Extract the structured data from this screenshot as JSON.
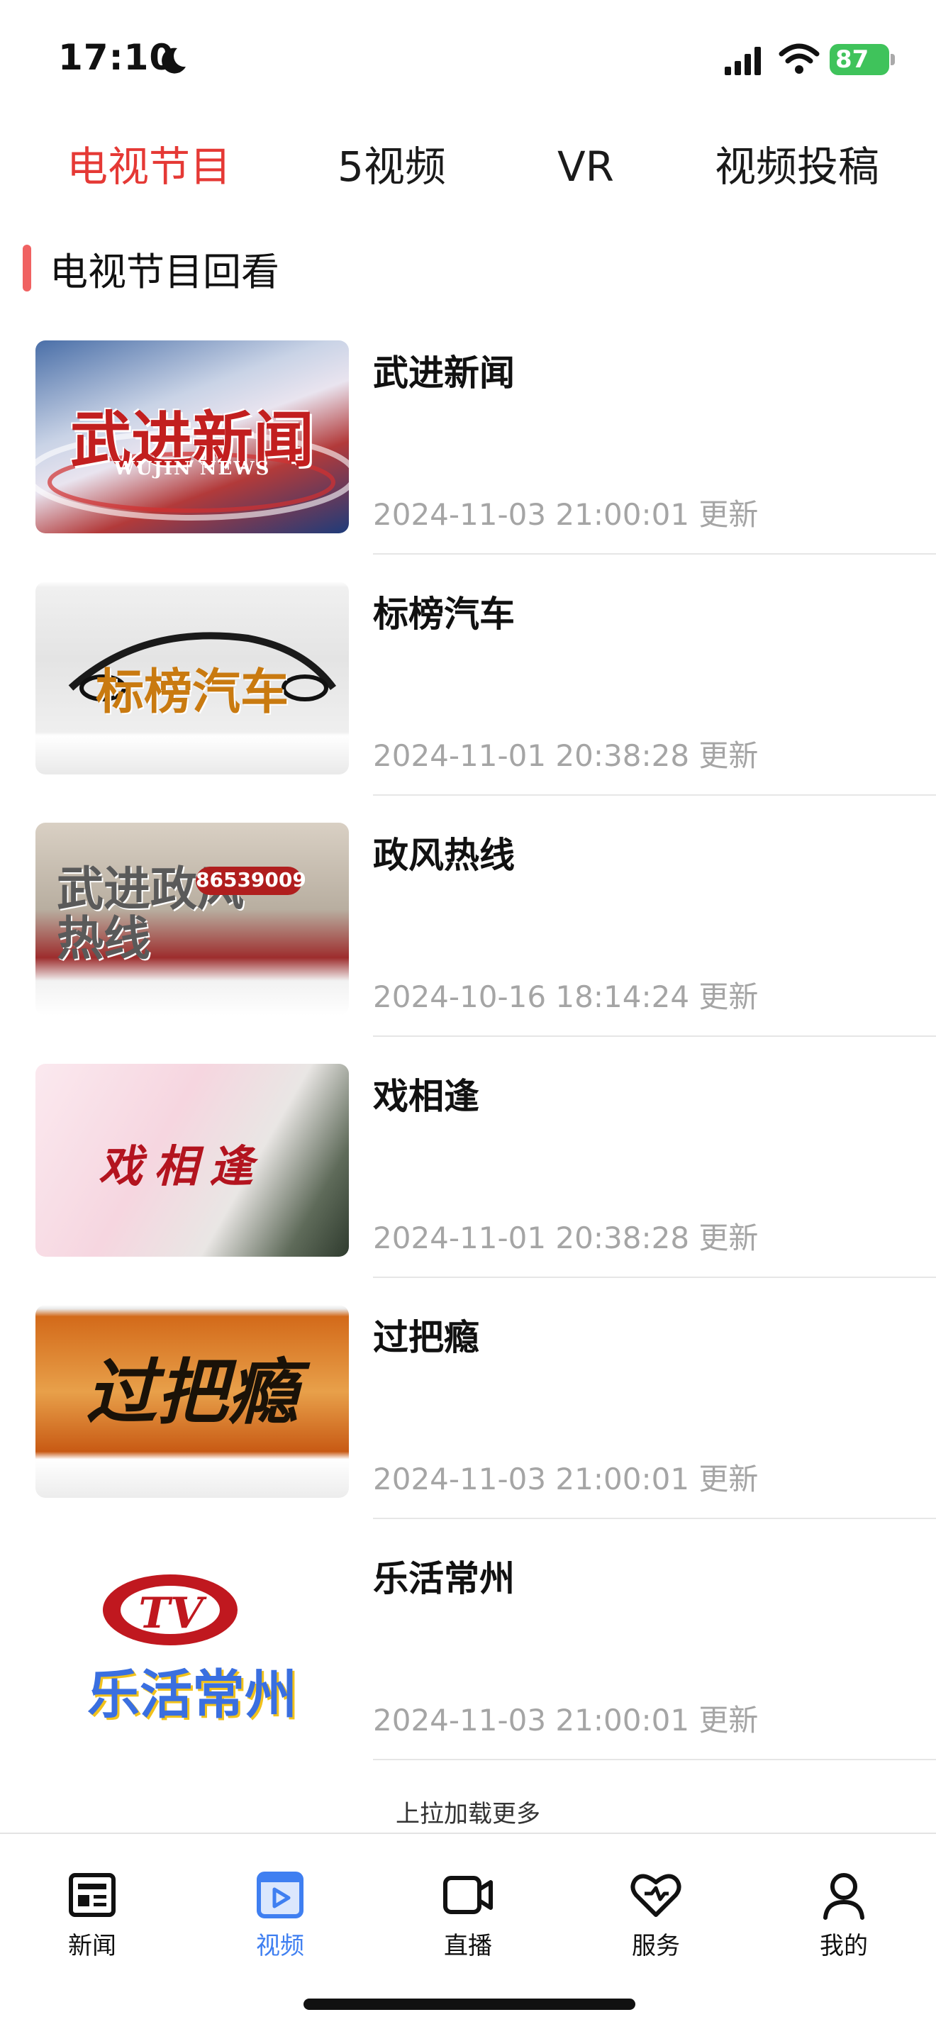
{
  "status": {
    "time": "17:10",
    "battery": "87"
  },
  "top_tabs": [
    {
      "label": "电视节目",
      "active": true
    },
    {
      "label": "5视频",
      "active": false
    },
    {
      "label": "VR",
      "active": false
    },
    {
      "label": "视频投稿",
      "active": false
    }
  ],
  "section": {
    "title": "电视节目回看"
  },
  "programs": [
    {
      "title": "武进新闻",
      "date": "2024-11-03 21:00:01 更新",
      "thumb_text": "武进新闻",
      "thumb_subtext": "WUJIN NEWS"
    },
    {
      "title": "标榜汽车",
      "date": "2024-11-01 20:38:28 更新",
      "thumb_text": "标榜汽车"
    },
    {
      "title": "政风热线",
      "date": "2024-10-16 18:14:24 更新",
      "thumb_text": "武进政风热线",
      "thumb_subtext": "86539009"
    },
    {
      "title": "戏相逢",
      "date": "2024-11-01 20:38:28 更新",
      "thumb_text": "戏相逢"
    },
    {
      "title": "过把瘾",
      "date": "2024-11-03 21:00:01 更新",
      "thumb_text": "过把瘾"
    },
    {
      "title": "乐活常州",
      "date": "2024-11-03 21:00:01 更新",
      "thumb_text": "乐活常州",
      "thumb_subtext": "TV"
    }
  ],
  "load_more": "上拉加载更多",
  "bottom_nav": [
    {
      "label": "新闻",
      "icon": "newspaper-icon",
      "active": false
    },
    {
      "label": "视频",
      "icon": "video-icon",
      "active": true
    },
    {
      "label": "直播",
      "icon": "camera-icon",
      "active": false
    },
    {
      "label": "服务",
      "icon": "heart-icon",
      "active": false
    },
    {
      "label": "我的",
      "icon": "profile-icon",
      "active": false
    }
  ],
  "colors": {
    "accent": "#e53935",
    "nav_active": "#3f7ff1",
    "section_bar": "#f06262",
    "date": "#a5a5a5"
  }
}
